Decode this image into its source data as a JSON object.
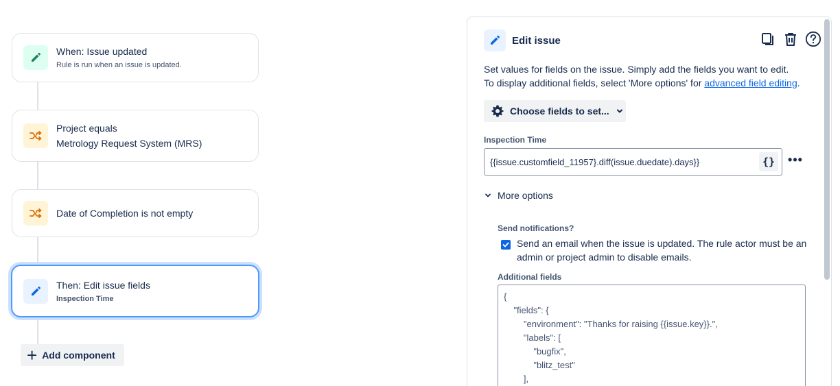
{
  "flow": {
    "trigger": {
      "title": "When: Issue updated",
      "subtitle": "Rule is run when an issue is updated."
    },
    "condition1": {
      "title": "Project equals",
      "subtitle": "Metrology Request System (MRS)"
    },
    "condition2": {
      "title": "Date of Completion is not empty"
    },
    "action": {
      "title": "Then: Edit issue fields",
      "subtitle": "Inspection Time"
    },
    "add_component_label": "Add component"
  },
  "panel": {
    "title": "Edit issue",
    "desc_line1": "Set values for fields on the issue. Simply add the fields you want to edit.",
    "desc_line2_prefix": "To display additional fields, select 'More options' for ",
    "desc_link": "advanced field editing",
    "desc_line2_suffix": ".",
    "choose_fields_label": "Choose fields to set...",
    "field_label": "Inspection Time",
    "field_value": "{{issue.customfield_11957}.diff(issue.duedate).days}}",
    "brace_label": "{}",
    "more_options_label": "More options",
    "notifications_label": "Send notifications?",
    "notifications_text": "Send an email when the issue is updated. The rule actor must be an admin or project admin to disable emails.",
    "notifications_checked": true,
    "additional_fields_label": "Additional fields",
    "additional_fields_value": "{\n    \"fields\": {\n        \"environment\": \"Thanks for raising {{issue.key}}.\",\n        \"labels\": [\n            \"bugfix\",\n            \"blitz_test\"\n        ],"
  },
  "colors": {
    "accent": "#0c66e4",
    "selected_border": "#4c9aff",
    "trigger_icon": "#1f845a",
    "condition_icon": "#d97008",
    "action_icon": "#0c66e4"
  },
  "icons": {
    "trigger": "pencil-icon",
    "condition": "shuffle-icon",
    "action": "pencil-icon",
    "copy": "copy-icon",
    "delete": "trash-icon",
    "help": "help-icon",
    "settings": "gear-icon"
  }
}
